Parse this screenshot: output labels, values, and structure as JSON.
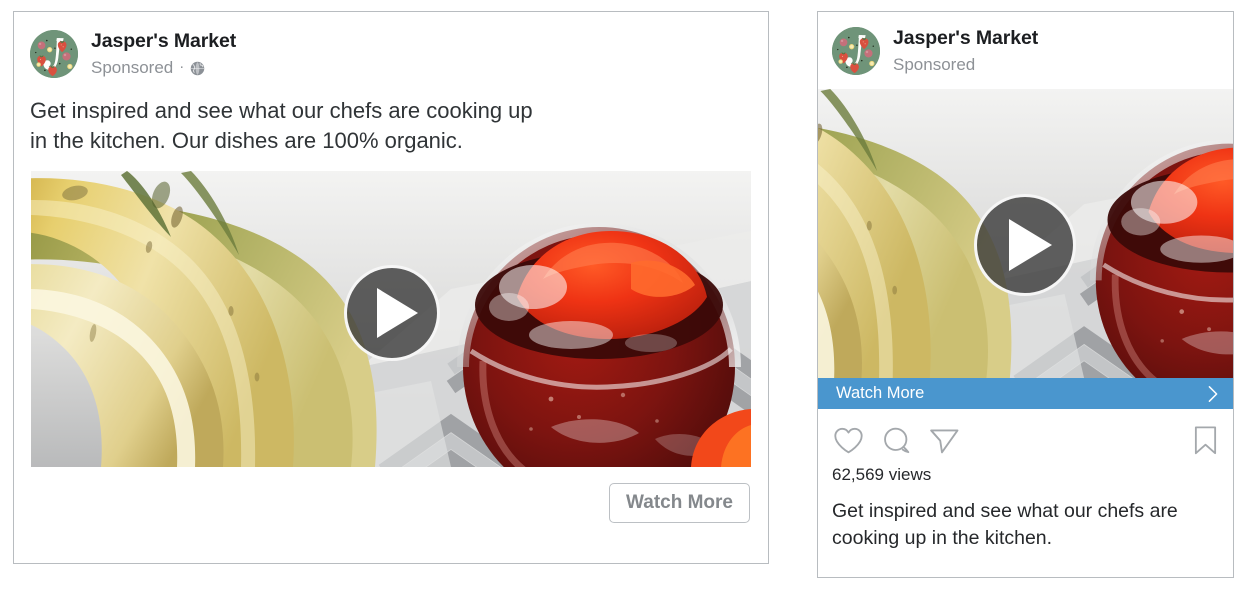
{
  "facebook_ad": {
    "brand": {
      "name": "Jasper's Market",
      "sponsored_label": "Sponsored",
      "separator": "·",
      "privacy_icon": "globe-icon",
      "avatar_icon": "jaspers-market-avatar"
    },
    "body_text_line1": "Get inspired and see what our chefs are cooking up",
    "body_text_line2": "in the kitchen. Our dishes are 100% organic.",
    "media": {
      "type": "video",
      "play_icon": "play-icon",
      "alt": "Bananas and a glass of red fruit drink on a gray chevron cloth"
    },
    "cta_label": "Watch More"
  },
  "instagram_ad": {
    "brand": {
      "name": "Jasper's Market",
      "sponsored_label": "Sponsored",
      "avatar_icon": "jaspers-market-avatar"
    },
    "media": {
      "type": "video",
      "play_icon": "play-icon",
      "alt": "Bananas and a glass of red fruit drink on a gray chevron cloth"
    },
    "cta_label": "Watch More",
    "cta_chevron_icon": "chevron-right-icon",
    "actions": [
      {
        "icon": "heart-icon",
        "name": "like-button"
      },
      {
        "icon": "comment-icon",
        "name": "comment-button"
      },
      {
        "icon": "share-icon",
        "name": "share-button"
      },
      {
        "icon": "bookmark-icon",
        "name": "save-button"
      }
    ],
    "views_count": "62,569 views",
    "caption_line1": "Get inspired and see what our chefs are",
    "caption_line2": "cooking up in the kitchen."
  },
  "colors": {
    "cta_blue": "#4a96ce",
    "card_border": "#b8bcc0",
    "brand_text": "#1c1e21",
    "muted_text": "#8d9196",
    "body_text": "#303437",
    "avatar_green": "#6f9479"
  }
}
